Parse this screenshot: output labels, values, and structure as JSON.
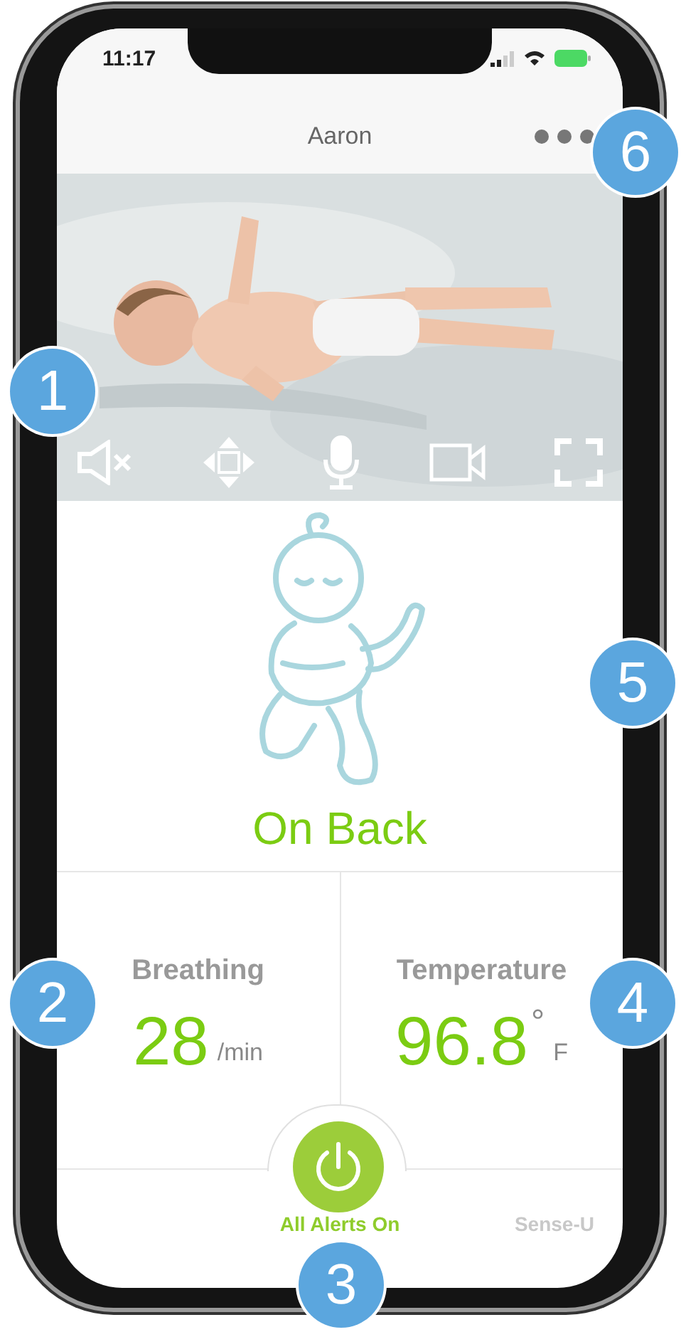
{
  "status_bar": {
    "time": "11:17"
  },
  "header": {
    "title": "Aaron"
  },
  "position": {
    "label": "On Back"
  },
  "stats": [
    {
      "label": "Breathing",
      "value": "28",
      "unit": "/min"
    },
    {
      "label": "Temperature",
      "value": "96.8",
      "degree": "°",
      "unit": "F"
    }
  ],
  "alerts": {
    "on": true,
    "label": "All Alerts On"
  },
  "brand": "Sense-U",
  "callouts": [
    "6",
    "1",
    "5",
    "2",
    "4",
    "3"
  ]
}
